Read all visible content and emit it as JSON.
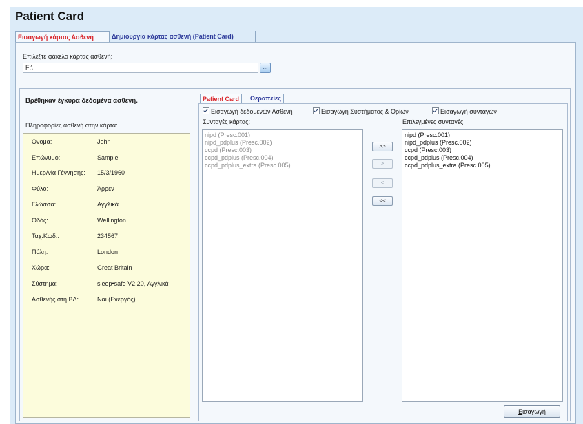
{
  "page": {
    "title": "Patient Card"
  },
  "main_tabs": [
    {
      "label": "Εισαγωγή κάρτας Ασθενή",
      "active": true
    },
    {
      "label": "Δημιουργία κάρτας ασθενή (Patient Card)",
      "active": false
    }
  ],
  "folder": {
    "label": "Επιλέξτε φάκελο κάρτας ασθενή:",
    "value": "F:\\",
    "browse_label": "..."
  },
  "status_message": "Βρέθηκαν έγκυρα δεδομένα ασθενή.",
  "patient_info": {
    "label": "Πληροφορίες ασθενή στην κάρτα:",
    "rows": [
      {
        "key": "Όνομα:",
        "value": "John"
      },
      {
        "key": "Επώνυμο:",
        "value": "Sample"
      },
      {
        "key": "Ημερ/νία Γέννησης:",
        "value": "15/3/1960"
      },
      {
        "key": "Φύλο:",
        "value": "Άρρεν"
      },
      {
        "key": "Γλώσσα:",
        "value": "Αγγλικά"
      },
      {
        "key": "Οδός:",
        "value": "Wellington"
      },
      {
        "key": "Ταχ.Κωδ.:",
        "value": "234567"
      },
      {
        "key": "Πόλη:",
        "value": "London"
      },
      {
        "key": "Χώρα:",
        "value": "Great Britain"
      },
      {
        "key": "Σύστημα:",
        "value": "sleep•safe V2.20, Αγγλικά"
      },
      {
        "key": "Ασθενής στη ΒΔ:",
        "value": "Ναι (Ενεργός)"
      }
    ]
  },
  "sub_tabs": [
    {
      "label": "Patient Card",
      "active": true
    },
    {
      "label": "Θεραπείες",
      "active": false
    }
  ],
  "checkboxes": [
    {
      "label": "Εισαγωγή δεδομένων Ασθενή",
      "checked": true
    },
    {
      "label": "Εισαγωγή Συστήματος & Ορίων",
      "checked": true
    },
    {
      "label": "Εισαγωγή συνταγών",
      "checked": true
    }
  ],
  "card_prescriptions": {
    "label": "Συνταγές κάρτας:",
    "items": [
      "nipd (Presc.001)",
      "nipd_pdplus (Presc.002)",
      "ccpd (Presc.003)",
      "ccpd_pdplus (Presc.004)",
      "ccpd_pdplus_extra (Presc.005)"
    ]
  },
  "selected_prescriptions": {
    "label": "Επιλεγμένες συνταγές:",
    "items": [
      "nipd (Presc.001)",
      "nipd_pdplus (Presc.002)",
      "ccpd (Presc.003)",
      "ccpd_pdplus (Presc.004)",
      "ccpd_pdplus_extra (Presc.005)"
    ]
  },
  "transfer_buttons": [
    {
      "label": ">>",
      "enabled": true
    },
    {
      "label": ">",
      "enabled": false
    },
    {
      "label": "<",
      "enabled": false
    },
    {
      "label": "<<",
      "enabled": true
    }
  ],
  "import_button": {
    "label_first": "Ε",
    "label_rest": "ισαγωγή"
  }
}
